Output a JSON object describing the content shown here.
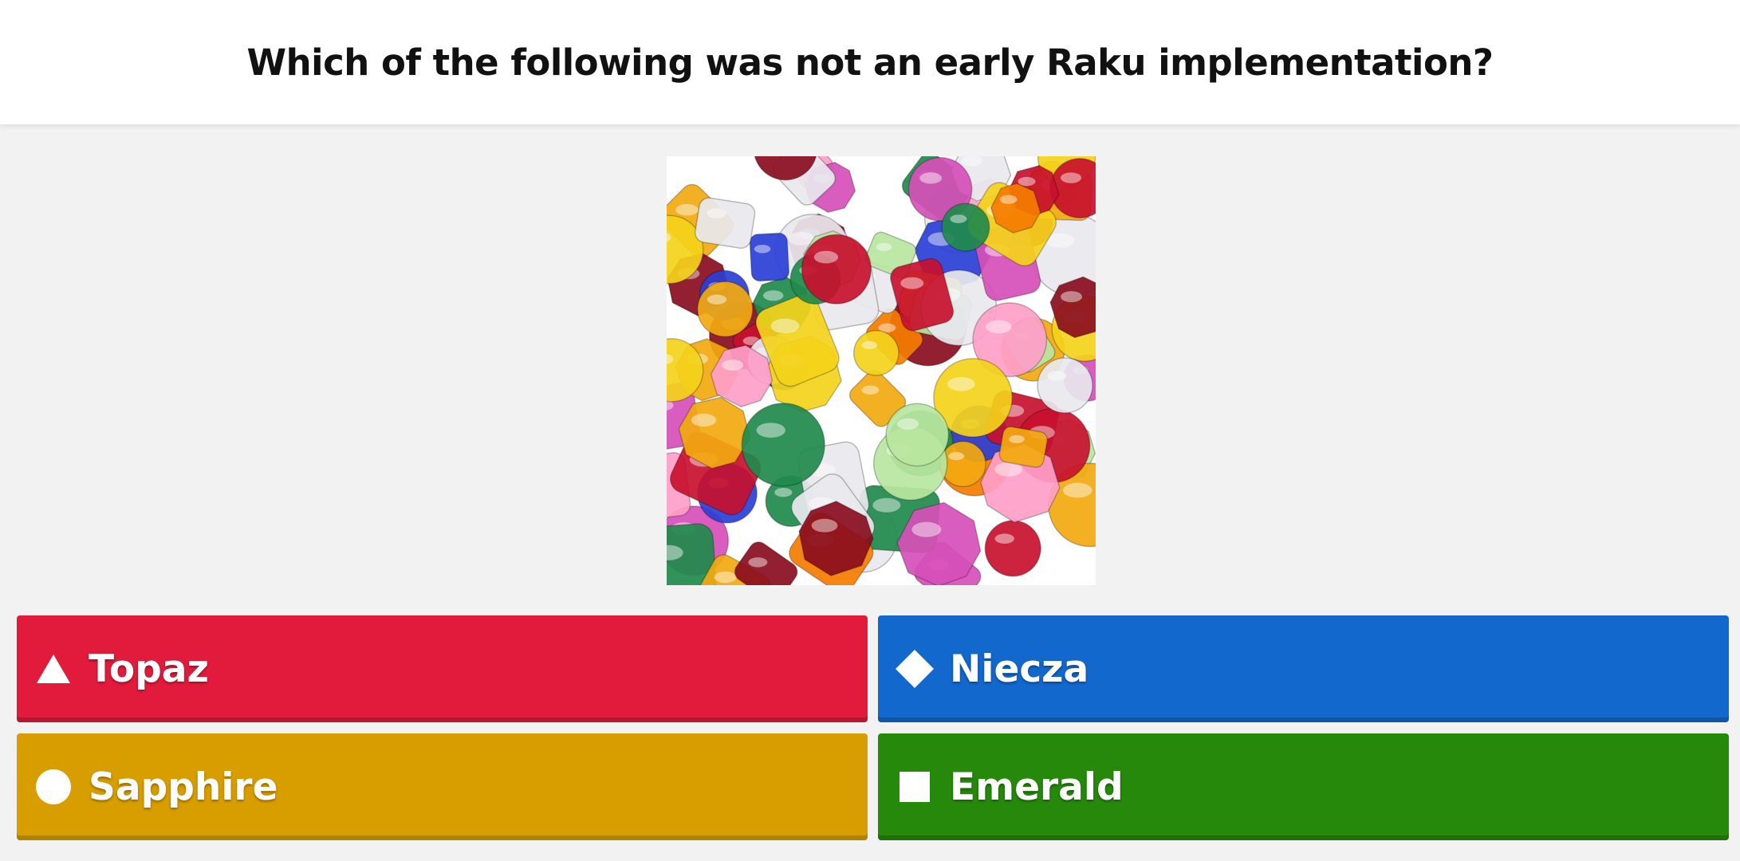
{
  "question": {
    "text": "Which of the following was not an early Raku implementation?"
  },
  "media": {
    "icon": "gemstones-image"
  },
  "answers": [
    {
      "label": "Topaz",
      "shape": "triangle-icon",
      "color": "#e21b3c"
    },
    {
      "label": "Niecza",
      "shape": "diamond-icon",
      "color": "#1368ce"
    },
    {
      "label": "Sapphire",
      "shape": "circle-icon",
      "color": "#d89e00"
    },
    {
      "label": "Emerald",
      "shape": "square-icon",
      "color": "#26890c"
    }
  ]
}
